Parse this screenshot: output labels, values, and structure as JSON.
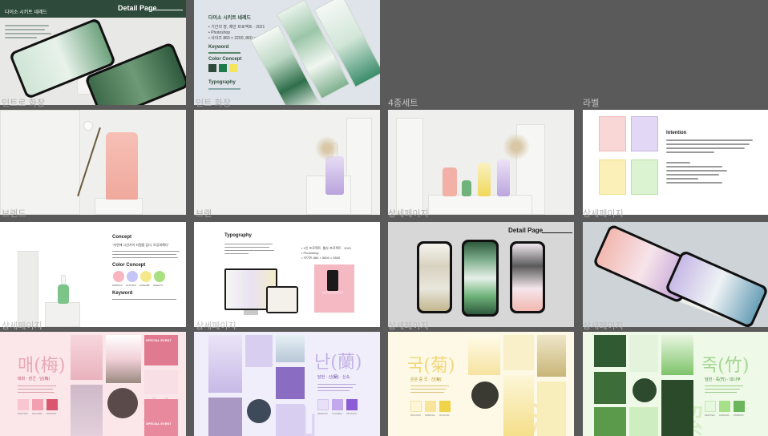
{
  "colors": {
    "dark_green": "#2d4a3a",
    "detail_line": "#ffffff",
    "pink": "#f2b8b0",
    "lavender": "#c9b6e2",
    "yellow": "#f2e08a",
    "green": "#aee39a",
    "plum_red": "#d9566f",
    "orchid": "#8a5cd6",
    "mum_yellow": "#f1d34a",
    "bamboo_green": "#6bb65a"
  },
  "tile1": {
    "brand": "다이소 시키트 네레드",
    "detail_page": "Detail Page"
  },
  "tile2": {
    "brand": "다이소 시키트 네레드",
    "bullets": [
      "• 기간의 장, 제안 프로젝트 · 2021",
      "• Photoshop",
      "• 사이즈 860 × 2200, 860 × 4000"
    ],
    "keyword": "Keyword",
    "color_concept": "Color Concept",
    "typography": "Typography"
  },
  "row_labels": {
    "r1": [
      "인트로 화장",
      "인트 화장",
      "4종세트",
      "라벨"
    ],
    "r2": [
      "브랜드",
      "브랜",
      "상세페이지",
      "상세페이지"
    ],
    "r3": [
      "상세페이지",
      "상세페이지",
      "상세페이지",
      "상세페이지"
    ]
  },
  "tile8": {
    "title": "Intention"
  },
  "tile9": {
    "concept": "Concept",
    "quote": "\"자연에 시선가이 지필을 담다, 모공피해다\"",
    "color_concept": "Color Concept",
    "swatch_labels": [
      "#F8B5C0",
      "#C5C5F8",
      "#F3E98B",
      "#A8E07F"
    ],
    "keyword": "Keyword"
  },
  "tile10": {
    "typography": "Typography",
    "bullets": [
      "• 1인 프로젝트, 웹사 프로젝트 · 2021",
      "• Photoshop",
      "• 사이즈 860 × 5800 × 5500"
    ]
  },
  "tile11": {
    "detail_page": "Detail Page"
  },
  "tile13": {
    "big_char": "매(梅)",
    "sub": "매화 · 장군 · 남(梅)",
    "deco": "花",
    "event": "SPECIAL EVENT",
    "swatch_labels": [
      "#F8C5D0",
      "#F2A0B0",
      "#D9566F"
    ]
  },
  "tile14": {
    "big_char": "난(蘭)",
    "sub": "담헌 · 신(蘭) · 신속",
    "deco": "仙",
    "swatch_labels": [
      "#E8E0F8",
      "#C2A8EC",
      "#8A5CD6"
    ]
  },
  "tile15": {
    "big_char": "국(菊)",
    "sub": "은은 중 국 · 신(菊)",
    "deco": "潤",
    "swatch_labels": [
      "#FFF6D8",
      "#F8E59A",
      "#F1D34A"
    ]
  },
  "tile16": {
    "big_char": "죽(竹)",
    "sub": "담헌 · 죽(竹) · 대나무",
    "deco": "潔",
    "swatch_labels": [
      "#E8F8E0",
      "#A8E08A",
      "#6BB65A"
    ]
  }
}
